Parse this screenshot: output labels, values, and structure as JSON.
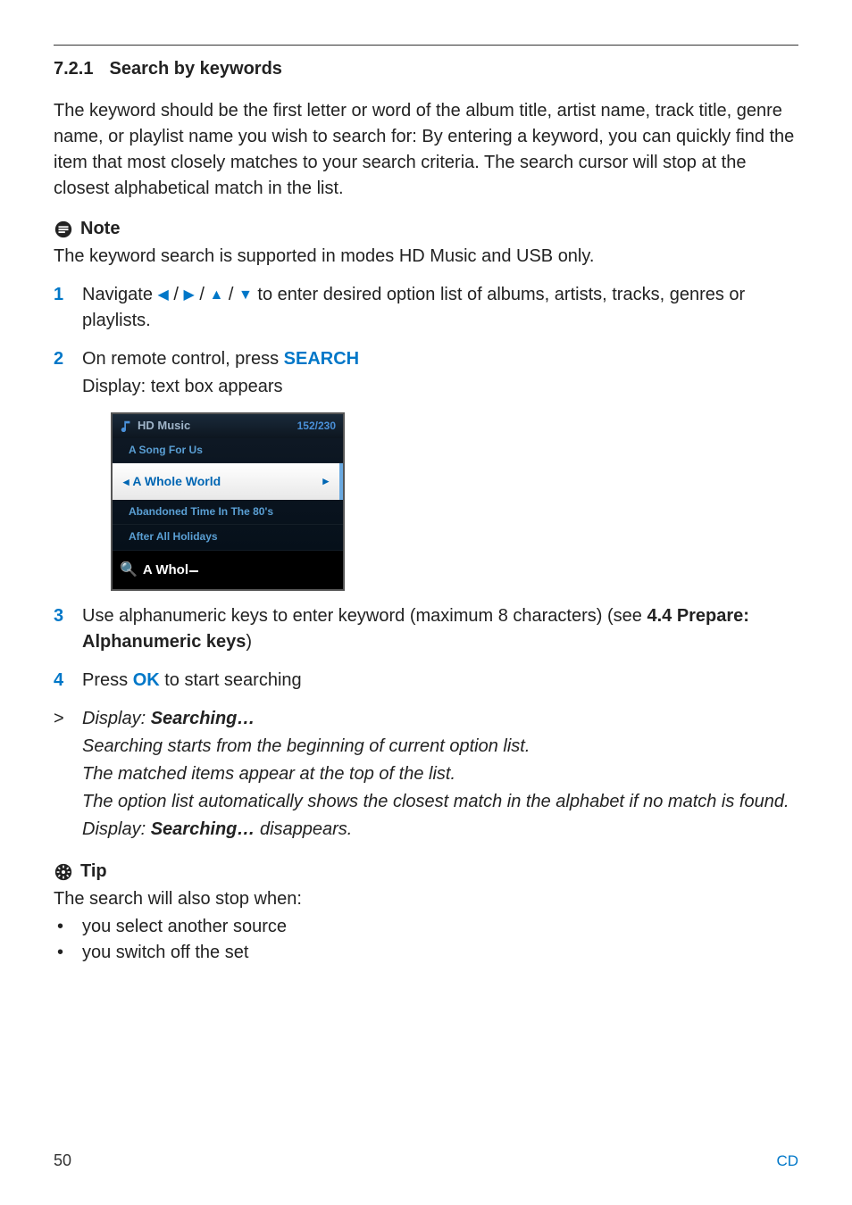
{
  "heading": {
    "number": "7.2.1",
    "title": "Search by keywords"
  },
  "intro": "The keyword should be the first letter or word of the album title, artist name, track title, genre name, or playlist name you wish to search for: By entering a keyword, you can quickly find the item that most closely matches to your search criteria. The search cursor will stop at the closest alphabetical match in the list.",
  "note": {
    "label": "Note",
    "text": "The keyword search is supported in modes HD Music and USB only."
  },
  "steps": {
    "s1": {
      "num": "1",
      "pre": "Navigate ",
      "post": " to enter desired option list of albums, artists, tracks, genres or playlists."
    },
    "s2": {
      "num": "2",
      "line1a": "On remote control, press ",
      "btn": "SEARCH",
      "line2": "Display: text box appears"
    },
    "s3": {
      "num": "3",
      "text_a": "Use alphanumeric keys to enter keyword (maximum 8 characters) (see ",
      "bold": "4.4 Prepare: Alphanumeric keys",
      "text_b": ")"
    },
    "s4": {
      "num": "4",
      "pre": "Press ",
      "btn": "OK",
      "post": " to start searching"
    }
  },
  "result": {
    "marker": ">",
    "l1a": "Display: ",
    "l1b": "Searching…",
    "l2": "Searching starts from the beginning of current option list.",
    "l3": "The matched items appear at the top of the list.",
    "l4": "The option list automatically shows the closest match in the alphabet if no match is found.",
    "l5a": "Display: ",
    "l5b": "Searching…",
    "l5c": " disappears."
  },
  "tip": {
    "label": "Tip",
    "intro": "The search will also stop when:",
    "b1": "you select another source",
    "b2": "you switch off the set"
  },
  "screenshot": {
    "title": "HD Music",
    "count": "152/230",
    "items": {
      "i0": "A Song For Us",
      "i1": "A Whole World",
      "i2": "Abandoned Time In The 80's",
      "i3": "After All Holidays"
    },
    "search_text": "A Whol"
  },
  "footer": {
    "page": "50",
    "section": "CD"
  }
}
